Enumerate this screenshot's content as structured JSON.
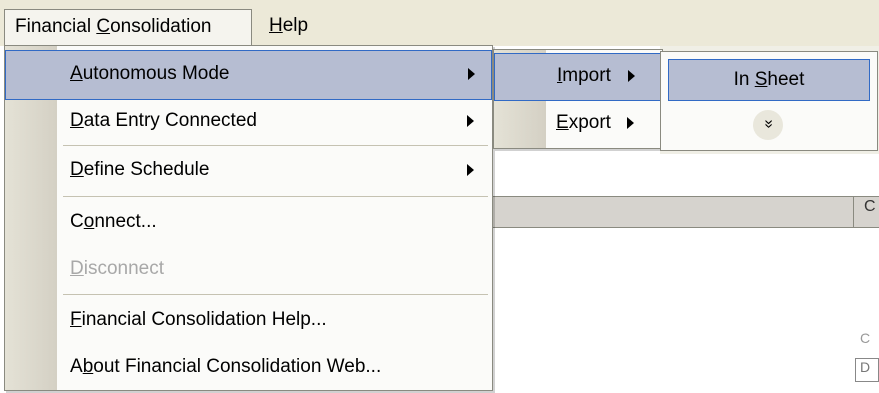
{
  "menubar": {
    "items": [
      {
        "pre": "Financial ",
        "key": "C",
        "post": "onsolidation"
      },
      {
        "pre": "",
        "key": "H",
        "post": "elp"
      }
    ]
  },
  "main_menu": {
    "items": [
      {
        "pre": "",
        "key": "A",
        "post": "utonomous Mode",
        "arrow": true,
        "highlighted": true
      },
      {
        "pre": "",
        "key": "D",
        "post": "ata Entry Connected",
        "arrow": true
      },
      {
        "pre": "",
        "key": "D",
        "post": "efine Schedule",
        "arrow": true
      },
      {
        "pre": "C",
        "key": "o",
        "post": "nnect..."
      },
      {
        "pre": "",
        "key": "D",
        "post": "isconnect",
        "disabled": true
      },
      {
        "pre": "",
        "key": "F",
        "post": "inancial Consolidation Help..."
      },
      {
        "pre": "A",
        "key": "b",
        "post": "out Financial Consolidation Web..."
      }
    ]
  },
  "autonomous_submenu": {
    "items": [
      {
        "pre": "",
        "key": "I",
        "post": "mport",
        "arrow": true,
        "highlighted": true
      },
      {
        "pre": "",
        "key": "E",
        "post": "xport",
        "arrow": true
      }
    ]
  },
  "import_submenu": {
    "item": {
      "pre": "In ",
      "key": "S",
      "post": "heet"
    },
    "expand_glyph": "»"
  },
  "background": {
    "grid_glyph": "C",
    "side_c": "C",
    "side_d": "D"
  }
}
